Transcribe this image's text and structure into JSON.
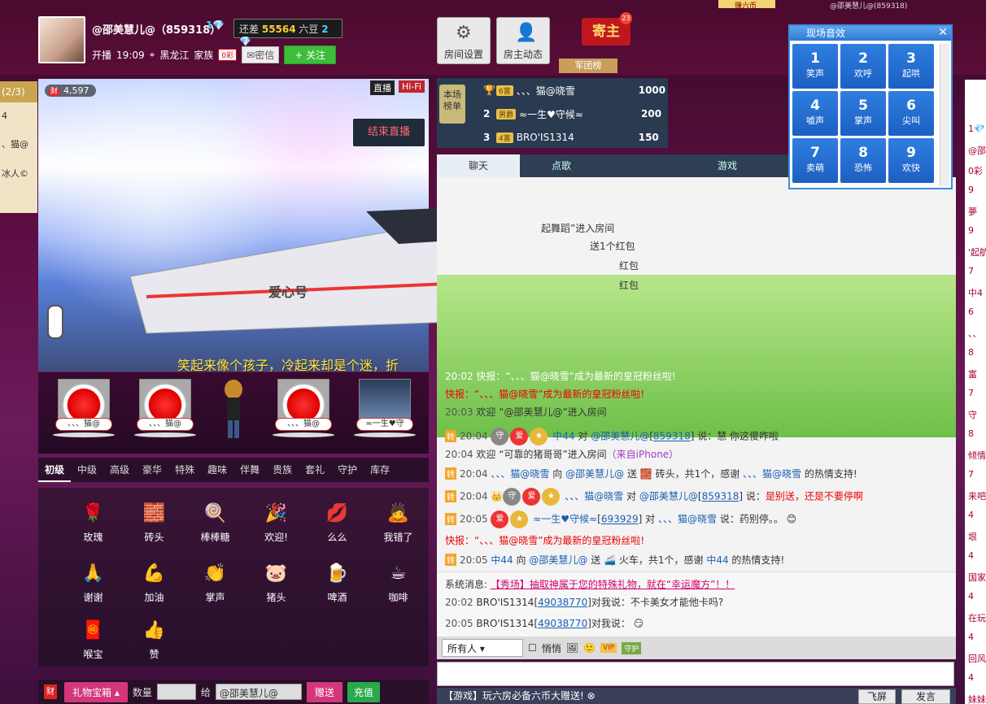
{
  "header": {
    "host_name": "@邵美慧儿@（859318）",
    "diamond_level": "1💎",
    "gap_prefix": "还差",
    "gap_amount": "55564",
    "gap_unit": "六豆",
    "gap_next": "2💎",
    "live_label": "开播",
    "live_time": "19:09",
    "location": "黑龙江",
    "family_label": "家族",
    "family_tag": "0彩",
    "mail_label": "密信",
    "follow_label": "关注",
    "room_settings_label": "房间设置",
    "host_activity_label": "房主动态",
    "jizhu_label": "寄主",
    "jizhu_count": "23",
    "juntuan_label": "军团榜"
  },
  "sound_panel": {
    "title": "现场音效",
    "close": "✕",
    "keys": [
      {
        "n": "1",
        "label": "笑声"
      },
      {
        "n": "2",
        "label": "欢呼"
      },
      {
        "n": "3",
        "label": "起哄"
      },
      {
        "n": "4",
        "label": "嘘声"
      },
      {
        "n": "5",
        "label": "掌声"
      },
      {
        "n": "6",
        "label": "尖叫"
      },
      {
        "n": "7",
        "label": "卖萌"
      },
      {
        "n": "8",
        "label": "恐怖"
      },
      {
        "n": "9",
        "label": "欢快"
      }
    ]
  },
  "top_strip": {
    "left": "赚六币",
    "right": "@邵美慧儿@(859318)"
  },
  "left_strip": {
    "header": "(2/3)",
    "r1": "4",
    "r2": "、猫@",
    "r3": "冰人©"
  },
  "video": {
    "wealth_label": "财",
    "wealth_value": "4,597",
    "live_tag": "直播",
    "hifi_tag": "Hi-Fi",
    "end_live": "结束直播",
    "lyrics": "笑起来像个孩子，冷起来却是个迷，折",
    "train_text": "爱心号"
  },
  "seats": [
    {
      "name": "、、、猫@"
    },
    {
      "name": "、、、猫@"
    },
    {
      "name": "、、、猫@"
    },
    {
      "name": "≈一生♥守"
    }
  ],
  "gift_tabs": [
    "初级",
    "中级",
    "高级",
    "豪华",
    "特殊",
    "趣味",
    "伴舞",
    "贵族",
    "套礼",
    "守护",
    "库存"
  ],
  "gifts": [
    {
      "label": "玫瑰",
      "icon": "rose-icon",
      "glyph": "🌹"
    },
    {
      "label": "砖头",
      "icon": "brick-icon",
      "glyph": "🧱"
    },
    {
      "label": "棒棒糖",
      "icon": "lollipop-icon",
      "glyph": "🍭"
    },
    {
      "label": "欢迎!",
      "icon": "welcome-icon",
      "glyph": "🎉"
    },
    {
      "label": "么么",
      "icon": "kiss-icon",
      "glyph": "💋"
    },
    {
      "label": "我错了",
      "icon": "sorry-icon",
      "glyph": "🙇"
    },
    {
      "label": "谢谢",
      "icon": "thanks-icon",
      "glyph": "🙏"
    },
    {
      "label": "加油",
      "icon": "cheer-icon",
      "glyph": "💪"
    },
    {
      "label": "掌声",
      "icon": "applause-icon",
      "glyph": "👏"
    },
    {
      "label": "猪头",
      "icon": "pig-head-icon",
      "glyph": "🐷"
    },
    {
      "label": "啤酒",
      "icon": "beer-icon",
      "glyph": "🍺"
    },
    {
      "label": "咖啡",
      "icon": "coffee-icon",
      "glyph": "☕"
    },
    {
      "label": "喉宝",
      "icon": "throat-lozenge-icon",
      "glyph": "🧧"
    },
    {
      "label": "赞",
      "icon": "thumbs-up-icon",
      "glyph": "👍"
    }
  ],
  "giftbar": {
    "cai": "财",
    "giftbox": "礼物宝箱",
    "qty_label": "数量",
    "to_label": "给",
    "to_value": "@邵美慧儿@",
    "send": "赠送",
    "recharge": "充值"
  },
  "rank": {
    "badge": "本场榜单",
    "rows": [
      {
        "n": "1",
        "lv": "6富",
        "name": "、、、猫@晓雪",
        "amt": "1000"
      },
      {
        "n": "2",
        "lv": "男爵",
        "name": "≈一生♥守候≈",
        "amt": "200"
      },
      {
        "n": "3",
        "lv": "4富",
        "name": "BRO'IS1314",
        "amt": "150"
      }
    ]
  },
  "chat_tabs": [
    "聊天",
    "点歌",
    "",
    "游戏"
  ],
  "chat": {
    "l1": "起舞蹈”进入房间",
    "l2": "送1个红包",
    "l3": "红包",
    "l4": "红包",
    "l5": "20:02 快报：“、、、猫@晓雪”成为最新的皇冠粉丝啦!",
    "l6": "快报：“、、、猫@晓雪”成为最新的皇冠粉丝啦!",
    "l7_time": "20:03",
    "l7_text": "欢迎 “@邵美慧儿@”进入房间",
    "l8_time": "20:04",
    "l8_user": "中44",
    "l8_mid": "对",
    "l8_target": "@邵美慧儿@",
    "l8_id": "859318",
    "l8_say": "说：慧 你这傻咋啦",
    "l9_time": "20:04",
    "l9_text": "欢迎 “可靠的猪哥哥”进入房间",
    "l9_tail": "（来自iPhone）",
    "l10_time": "20:04",
    "l10_user": "、、、猫@晓雪",
    "l10_mid": "向",
    "l10_target": "@邵美慧儿@",
    "l10_send": "送",
    "l10_gift": "砖头，共1个，感谢",
    "l10_thanks": "、、、猫@晓雪",
    "l10_end": "的热情支持!",
    "l11_time": "20:04",
    "l11_user": "、、、猫@晓雪",
    "l11_mid": "对",
    "l11_target": "@邵美慧儿@",
    "l11_id": "859318",
    "l11_say": "说：",
    "l11_msg": "是别送，还是不要停啊",
    "l12_time": "20:05",
    "l12_user": "≈一生♥守候≈",
    "l12_id": "693929",
    "l12_mid": "对",
    "l12_target": "、、、猫@晓雪",
    "l12_say": "说：药别停。。",
    "l13": "快报：“、、、猫@晓雪”成为最新的皇冠粉丝啦!",
    "l14_time": "20:05",
    "l14_user": "中44",
    "l14_mid": "向",
    "l14_target": "@邵美慧儿@",
    "l14_send": "送",
    "l14_gift": "火车，共1个，感谢",
    "l14_thanks": "中44",
    "l14_end": "的热情支持!"
  },
  "system": {
    "label": "系统消息:",
    "msg": "【秀场】抽取神属于您的特殊礼物，就在“幸运魔方”！！",
    "p1_time": "20:02",
    "p1_user": "BRO'IS1314",
    "p1_id": "49038770",
    "p1_text": "对我说：不卡美女才能他卡吗?",
    "p2_time": "20:05",
    "p2_user": "BRO'IS1314",
    "p2_id": "49038770",
    "p2_text": "对我说："
  },
  "chatctl": {
    "target": "所有人",
    "whisper": "悄悄"
  },
  "chatfoot": "【游戏】玩六房必备六币大赠送!",
  "fly_screen": "飞屏",
  "send_msg": "发言",
  "right_list": [
    "1💎",
    "@邵",
    "0彩",
    "9",
    "夢",
    "9",
    "'起航",
    "7",
    "中4",
    "6",
    "、、",
    "8",
    "富",
    "7",
    "守",
    "8",
    "倾情",
    "7",
    "来吧",
    "4",
    "垠",
    "4",
    "国家",
    "4",
    "在玩",
    "4",
    "回风",
    "4",
    "妹妹"
  ]
}
